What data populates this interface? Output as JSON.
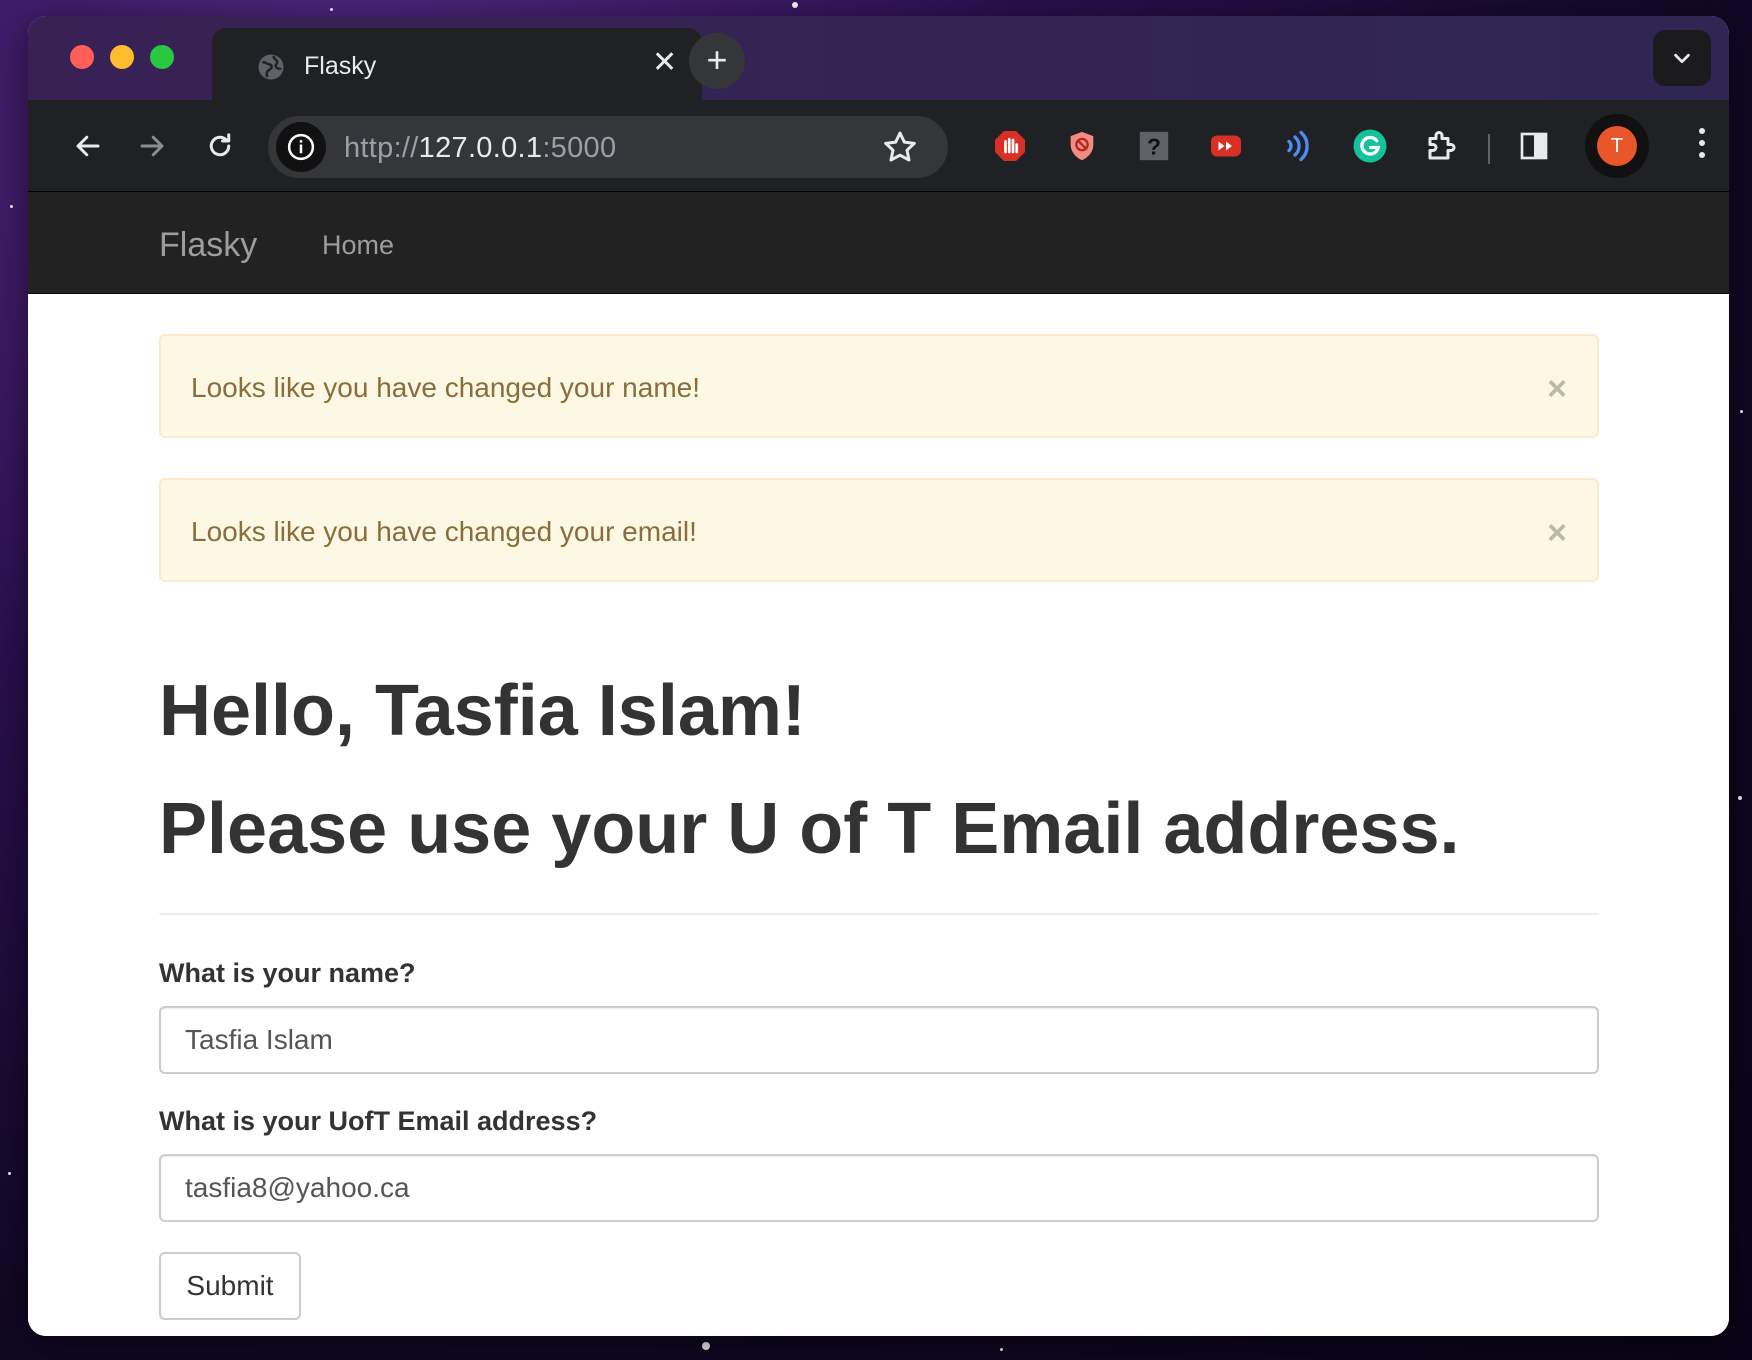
{
  "browser": {
    "tab_title": "Flasky",
    "tab_close": "✕",
    "new_tab": "+",
    "url_scheme": "http://",
    "url_host": "127.0.0.1",
    "url_port": ":5000",
    "profile_initial": "T"
  },
  "navbar": {
    "brand": "Flasky",
    "links": [
      "Home"
    ]
  },
  "alerts": [
    {
      "message": "Looks like you have changed your name!",
      "close": "×"
    },
    {
      "message": "Looks like you have changed your email!",
      "close": "×"
    }
  ],
  "main": {
    "greeting": "Hello, Tasfia Islam!",
    "subheading": "Please use your U of T Email address."
  },
  "form": {
    "name_label": "What is your name?",
    "name_value": "Tasfia Islam",
    "email_label": "What is your UofT Email address?",
    "email_value": "tasfia8@yahoo.ca",
    "submit_label": "Submit"
  },
  "colors": {
    "navbar_bg": "#222222",
    "alert_bg": "#fcf8e3",
    "alert_text": "#8a6d3b",
    "avatar": "#e8562a"
  }
}
